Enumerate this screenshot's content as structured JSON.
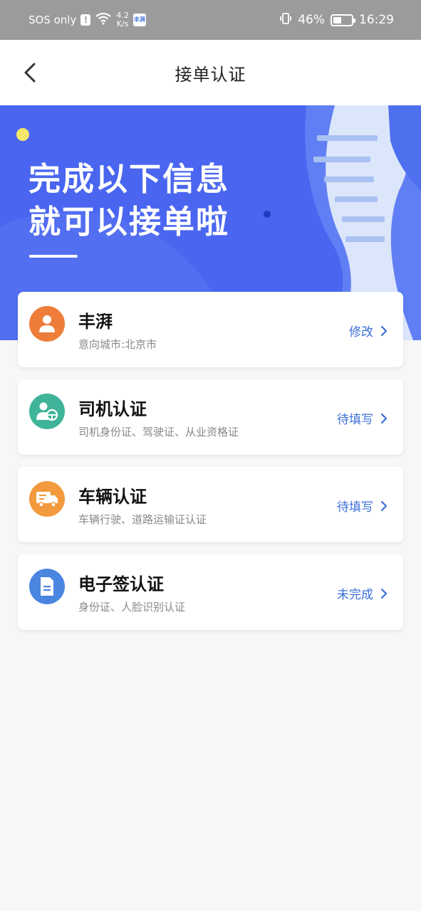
{
  "status_bar": {
    "carrier": "SOS only",
    "speed_value": "4.2",
    "speed_unit": "K/s",
    "app_badge": "丰湃",
    "battery": "46%",
    "battery_level": 0.46,
    "time": "16:29"
  },
  "header": {
    "title": "接单认证"
  },
  "banner": {
    "line1": "完成以下信息",
    "line2": "就可以接单啦"
  },
  "cards": [
    {
      "title": "丰湃",
      "subtitle": "意向城市:北京市",
      "action": "修改",
      "icon": "user-icon",
      "color": "#ee7d3a"
    },
    {
      "title": "司机认证",
      "subtitle": "司机身份证、驾驶证、从业资格证",
      "action": "待填写",
      "icon": "driver-wheel-icon",
      "color": "#3fb49a"
    },
    {
      "title": "车辆认证",
      "subtitle": "车辆行驶、道路运输证认证",
      "action": "待填写",
      "icon": "truck-icon",
      "color": "#f29a3d"
    },
    {
      "title": "电子签认证",
      "subtitle": "身份证、人脸识别认证",
      "action": "未完成",
      "icon": "document-icon",
      "color": "#4a86e0"
    }
  ],
  "colors": {
    "accent": "#3b6fd8",
    "banner": "#4a66f0"
  }
}
